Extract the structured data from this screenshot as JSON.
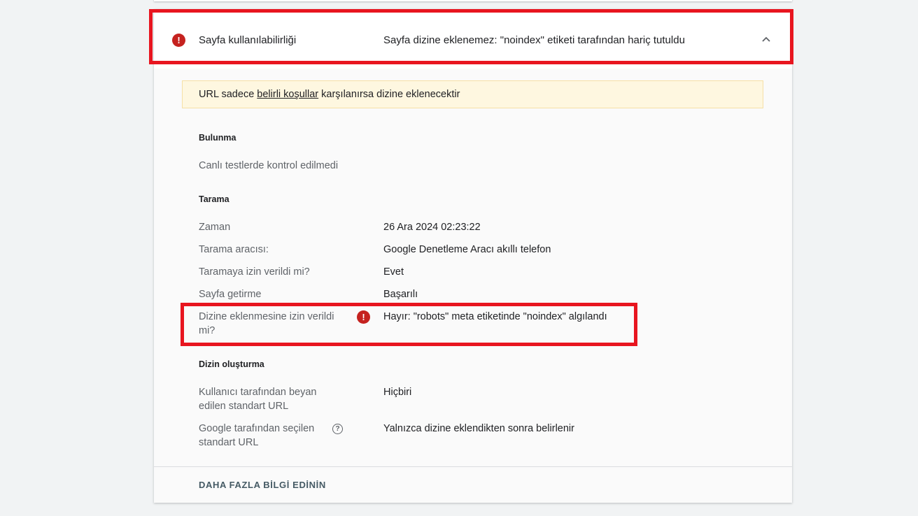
{
  "header": {
    "title": "Sayfa kullanılabilirliği",
    "status": "Sayfa dizine eklenemez: \"noindex\" etiketi tarafından hariç tutuldu"
  },
  "banner": {
    "prefix": "URL sadece ",
    "link": "belirli koşullar",
    "suffix": " karşılanırsa dizine eklenecektir"
  },
  "discovery": {
    "title": "Bulunma",
    "note": "Canlı testlerde kontrol edilmedi"
  },
  "crawl": {
    "title": "Tarama",
    "rows": [
      {
        "label": "Zaman",
        "value": "26 Ara 2024 02:23:22"
      },
      {
        "label": "Tarama aracısı:",
        "value": "Google Denetleme Aracı akıllı telefon"
      },
      {
        "label": "Taramaya izin verildi mi?",
        "value": "Evet"
      },
      {
        "label": "Sayfa getirme",
        "value": "Başarılı"
      }
    ],
    "indexing": {
      "label_line1": "Dizine eklenmesine izin verildi",
      "label_line2": "mi?",
      "value": "Hayır: \"robots\" meta etiketinde \"noindex\" algılandı"
    }
  },
  "indexing": {
    "title": "Dizin oluşturma",
    "user_canonical": {
      "label_line1": "Kullanıcı tarafından beyan",
      "label_line2": "edilen standart URL",
      "value": "Hiçbiri"
    },
    "google_canonical": {
      "label_line1": "Google tarafından seçilen",
      "label_line2": "standart URL",
      "value": "Yalnızca dizine eklendikten sonra belirlenir"
    }
  },
  "footer": {
    "learn_more": "DAHA FAZLA BİLGİ EDİNİN"
  },
  "icons": {
    "error": "error-icon",
    "collapse": "chevron-up-icon",
    "help": "help-icon"
  },
  "colors": {
    "error": "#c5221f",
    "highlight": "#e8151f",
    "banner_bg": "#fef7e0"
  }
}
